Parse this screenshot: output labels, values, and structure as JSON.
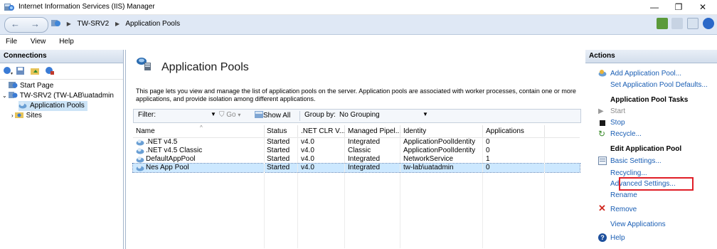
{
  "window": {
    "title": "Internet Information Services (IIS) Manager",
    "controls": {
      "minimize": "—",
      "maximize": "❐",
      "close": "✕"
    }
  },
  "address": {
    "crumbs": [
      "TW-SRV2",
      "Application Pools"
    ]
  },
  "menu": [
    "File",
    "View",
    "Help"
  ],
  "connections": {
    "header": "Connections",
    "tree": {
      "start_page": "Start Page",
      "server": "TW-SRV2 (TW-LAB\\uatadmin",
      "app_pools": "Application Pools",
      "sites": "Sites"
    }
  },
  "main": {
    "title": "Application Pools",
    "description": "This page lets you view and manage the list of application pools on the server. Application pools are associated with worker processes, contain one or more applications, and provide isolation among different applications.",
    "filter": {
      "label": "Filter:",
      "go": "Go",
      "show_all": "Show All",
      "group_by_label": "Group by:",
      "group_by_value": "No Grouping"
    },
    "columns": [
      "Name",
      "Status",
      ".NET CLR V...",
      "Managed Pipel...",
      "Identity",
      "Applications"
    ],
    "rows": [
      {
        "name": ".NET v4.5",
        "status": "Started",
        "clr": "v4.0",
        "pipeline": "Integrated",
        "identity": "ApplicationPoolIdentity",
        "apps": "0"
      },
      {
        "name": ".NET v4.5 Classic",
        "status": "Started",
        "clr": "v4.0",
        "pipeline": "Classic",
        "identity": "ApplicationPoolIdentity",
        "apps": "0"
      },
      {
        "name": "DefaultAppPool",
        "status": "Started",
        "clr": "v4.0",
        "pipeline": "Integrated",
        "identity": "NetworkService",
        "apps": "1"
      },
      {
        "name": "Nes App Pool",
        "status": "Started",
        "clr": "v4.0",
        "pipeline": "Integrated",
        "identity": "tw-lab\\uatadmin",
        "apps": "0"
      }
    ]
  },
  "actions": {
    "header": "Actions",
    "add": "Add Application Pool...",
    "set_defaults": "Set Application Pool Defaults...",
    "tasks_header": "Application Pool Tasks",
    "start": "Start",
    "stop": "Stop",
    "recycle": "Recycle...",
    "edit_header": "Edit Application Pool",
    "basic": "Basic Settings...",
    "recycling": "Recycling...",
    "advanced": "Advanced Settings...",
    "rename": "Rename",
    "remove": "Remove",
    "view_apps": "View Applications",
    "help": "Help"
  },
  "colors": {
    "link": "#1a5eb4",
    "selection": "#cce8ff",
    "highlight_box": "#e01e27"
  }
}
